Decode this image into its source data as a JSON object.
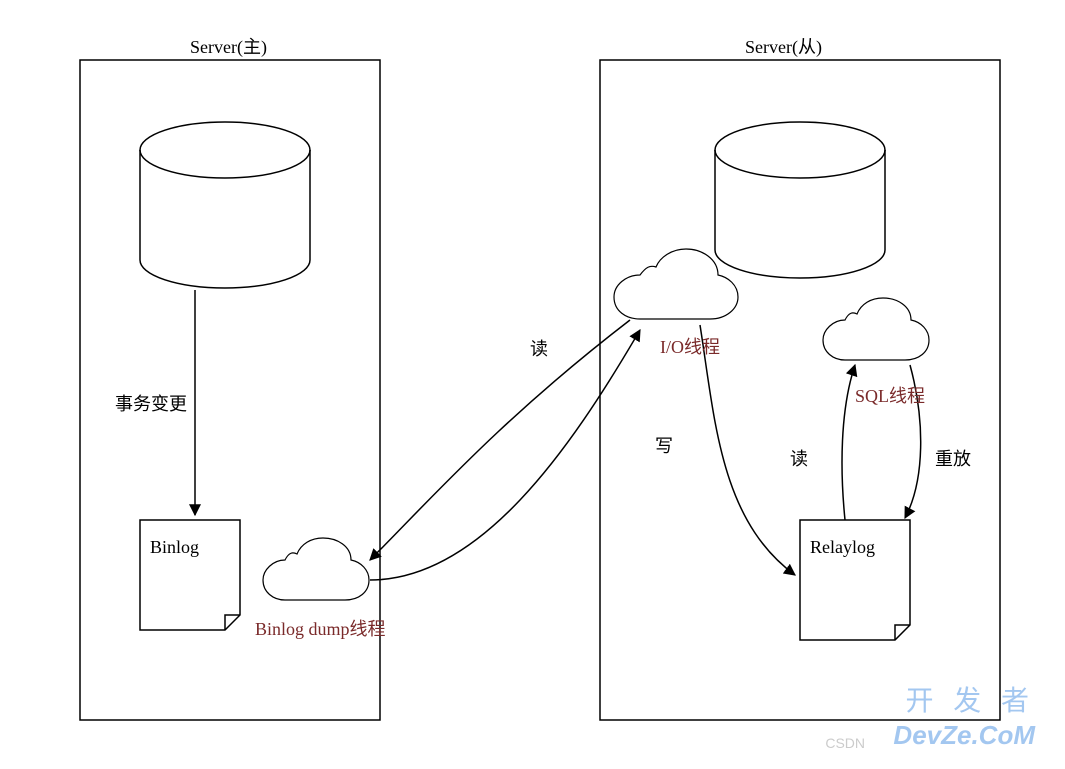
{
  "titles": {
    "master": "Server(主)",
    "slave": "Server(从)"
  },
  "labels": {
    "binlog": "Binlog",
    "relaylog": "Relaylog",
    "txn_change": "事务变更",
    "read1": "读",
    "write": "写",
    "read2": "读",
    "replay": "重放"
  },
  "threads": {
    "binlog_dump": "Binlog dump线程",
    "io_thread": "I/O线程",
    "sql_thread": "SQL线程"
  },
  "watermark": {
    "cn": "开 发 者",
    "en": "DevZe.CoM",
    "csdn": "CSDN"
  }
}
